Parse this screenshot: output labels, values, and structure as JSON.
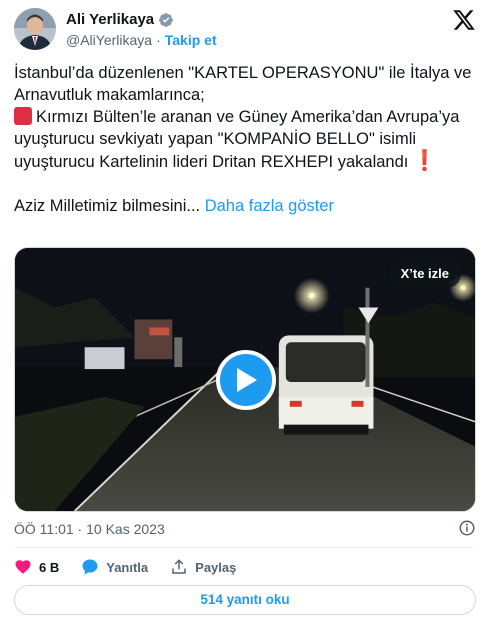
{
  "author": {
    "name": "Ali Yerlikaya",
    "handle": "@AliYerlikaya",
    "separator": "·",
    "follow_label": "Takip et"
  },
  "tweet": {
    "line1": "İstanbul’da düzenlenen \"KARTEL OPERASYONU\" ile İtalya ve Arnavutluk makamlarınca;",
    "line2": "Kırmızı Bülten’le aranan ve Güney Amerika’dan Avrupa’ya uyuşturucu sevkiyatı yapan \"KOMPANİO BELLO\" isimli uyuşturucu Kartelinin lideri Dritan REXHEPI yakalandı",
    "exclaim": "❗",
    "line3": "Aziz Milletimiz bilmesini...",
    "show_more": "Daha fazla göster"
  },
  "video": {
    "watch_on_x": "X’te izle"
  },
  "meta": {
    "timestamp": "ÖÖ 11:01 · 10 Kas 2023"
  },
  "actions": {
    "likes": "6 B",
    "reply_label": "Yanıtla",
    "share_label": "Paylaş"
  },
  "replies_button": "514 yanıtı oku",
  "colors": {
    "accent": "#1d9bf0",
    "like": "#f91880",
    "text": "#0f1419",
    "muted": "#536471"
  }
}
